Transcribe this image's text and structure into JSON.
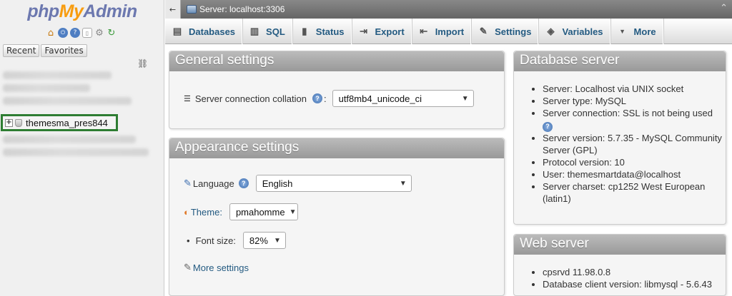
{
  "logo": {
    "php": "php",
    "my": "My",
    "admin": "Admin"
  },
  "nav": {
    "icons": [
      "home-icon",
      "logout-icon",
      "docs-icon",
      "settings-icon",
      "reload-icon"
    ],
    "tabs": [
      "Recent",
      "Favorites"
    ],
    "selected_db": "themesma_pres844",
    "expander": "+"
  },
  "topbar": {
    "title": "Server: localhost:3306",
    "collapse": "←",
    "right": "⌃"
  },
  "menu": [
    {
      "label": "Databases",
      "icon": "▤"
    },
    {
      "label": "SQL",
      "icon": "▥"
    },
    {
      "label": "Status",
      "icon": "▮"
    },
    {
      "label": "Export",
      "icon": "⇥"
    },
    {
      "label": "Import",
      "icon": "⇤"
    },
    {
      "label": "Settings",
      "icon": "✎"
    },
    {
      "label": "Variables",
      "icon": "◈"
    },
    {
      "label": "More",
      "icon": "▼"
    }
  ],
  "general": {
    "title": "General settings",
    "collation_label": "Server connection collation",
    "collation_suffix": ":",
    "collation_value": "utf8mb4_unicode_ci"
  },
  "appearance": {
    "title": "Appearance settings",
    "language_label": "Language",
    "language_value": "English",
    "theme_label": "Theme:",
    "theme_value": "pmahomme",
    "fontsize_label": "Font size:",
    "fontsize_value": "82%",
    "more_settings": "More settings"
  },
  "dbserver": {
    "title": "Database server",
    "items": [
      "Server: Localhost via UNIX socket",
      "Server type: MySQL",
      "Server connection: SSL is not being used",
      "Server version: 5.7.35 - MySQL Community Server (GPL)",
      "Protocol version: 10",
      "User: themesmartdata@localhost",
      "Server charset: cp1252 West European (latin1)"
    ]
  },
  "webserver": {
    "title": "Web server",
    "items": [
      "cpsrvd 11.98.0.8",
      "Database client version: libmysql - 5.6.43"
    ]
  },
  "colors": {
    "accent": "#235a81",
    "highlight": "#2e7d32",
    "logo_blue": "#6c78af",
    "logo_orange": "#f89c0e"
  }
}
